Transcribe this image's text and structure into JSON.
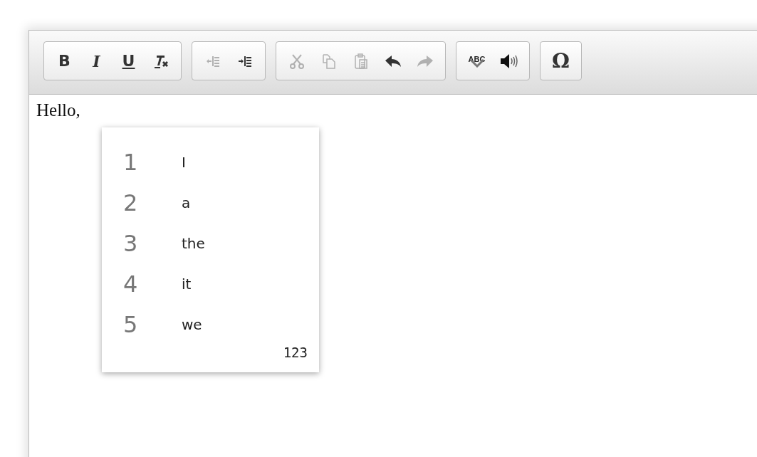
{
  "toolbar": {
    "groups": [
      {
        "buttons": [
          {
            "kind": "bold",
            "label": "B",
            "disabled": false
          },
          {
            "kind": "italic",
            "label": "I",
            "disabled": false
          },
          {
            "kind": "underline",
            "label": "U",
            "disabled": false
          },
          {
            "kind": "remove-format",
            "disabled": false
          }
        ]
      },
      {
        "buttons": [
          {
            "kind": "outdent",
            "disabled": true
          },
          {
            "kind": "indent",
            "disabled": false
          }
        ]
      },
      {
        "buttons": [
          {
            "kind": "cut",
            "disabled": true
          },
          {
            "kind": "copy",
            "disabled": true
          },
          {
            "kind": "paste",
            "disabled": true
          },
          {
            "kind": "undo",
            "disabled": false
          },
          {
            "kind": "redo",
            "disabled": true
          }
        ]
      },
      {
        "buttons": [
          {
            "kind": "spellcheck",
            "label": "ABC",
            "disabled": false
          },
          {
            "kind": "speak",
            "disabled": false
          }
        ]
      },
      {
        "buttons": [
          {
            "kind": "symbol",
            "label": "Ω",
            "disabled": false
          }
        ]
      }
    ]
  },
  "content": {
    "text": "Hello,"
  },
  "suggestions": {
    "items": [
      {
        "number": "1",
        "word": "I"
      },
      {
        "number": "2",
        "word": "a"
      },
      {
        "number": "3",
        "word": "the"
      },
      {
        "number": "4",
        "word": "it"
      },
      {
        "number": "5",
        "word": "we"
      }
    ],
    "footer": "123"
  }
}
